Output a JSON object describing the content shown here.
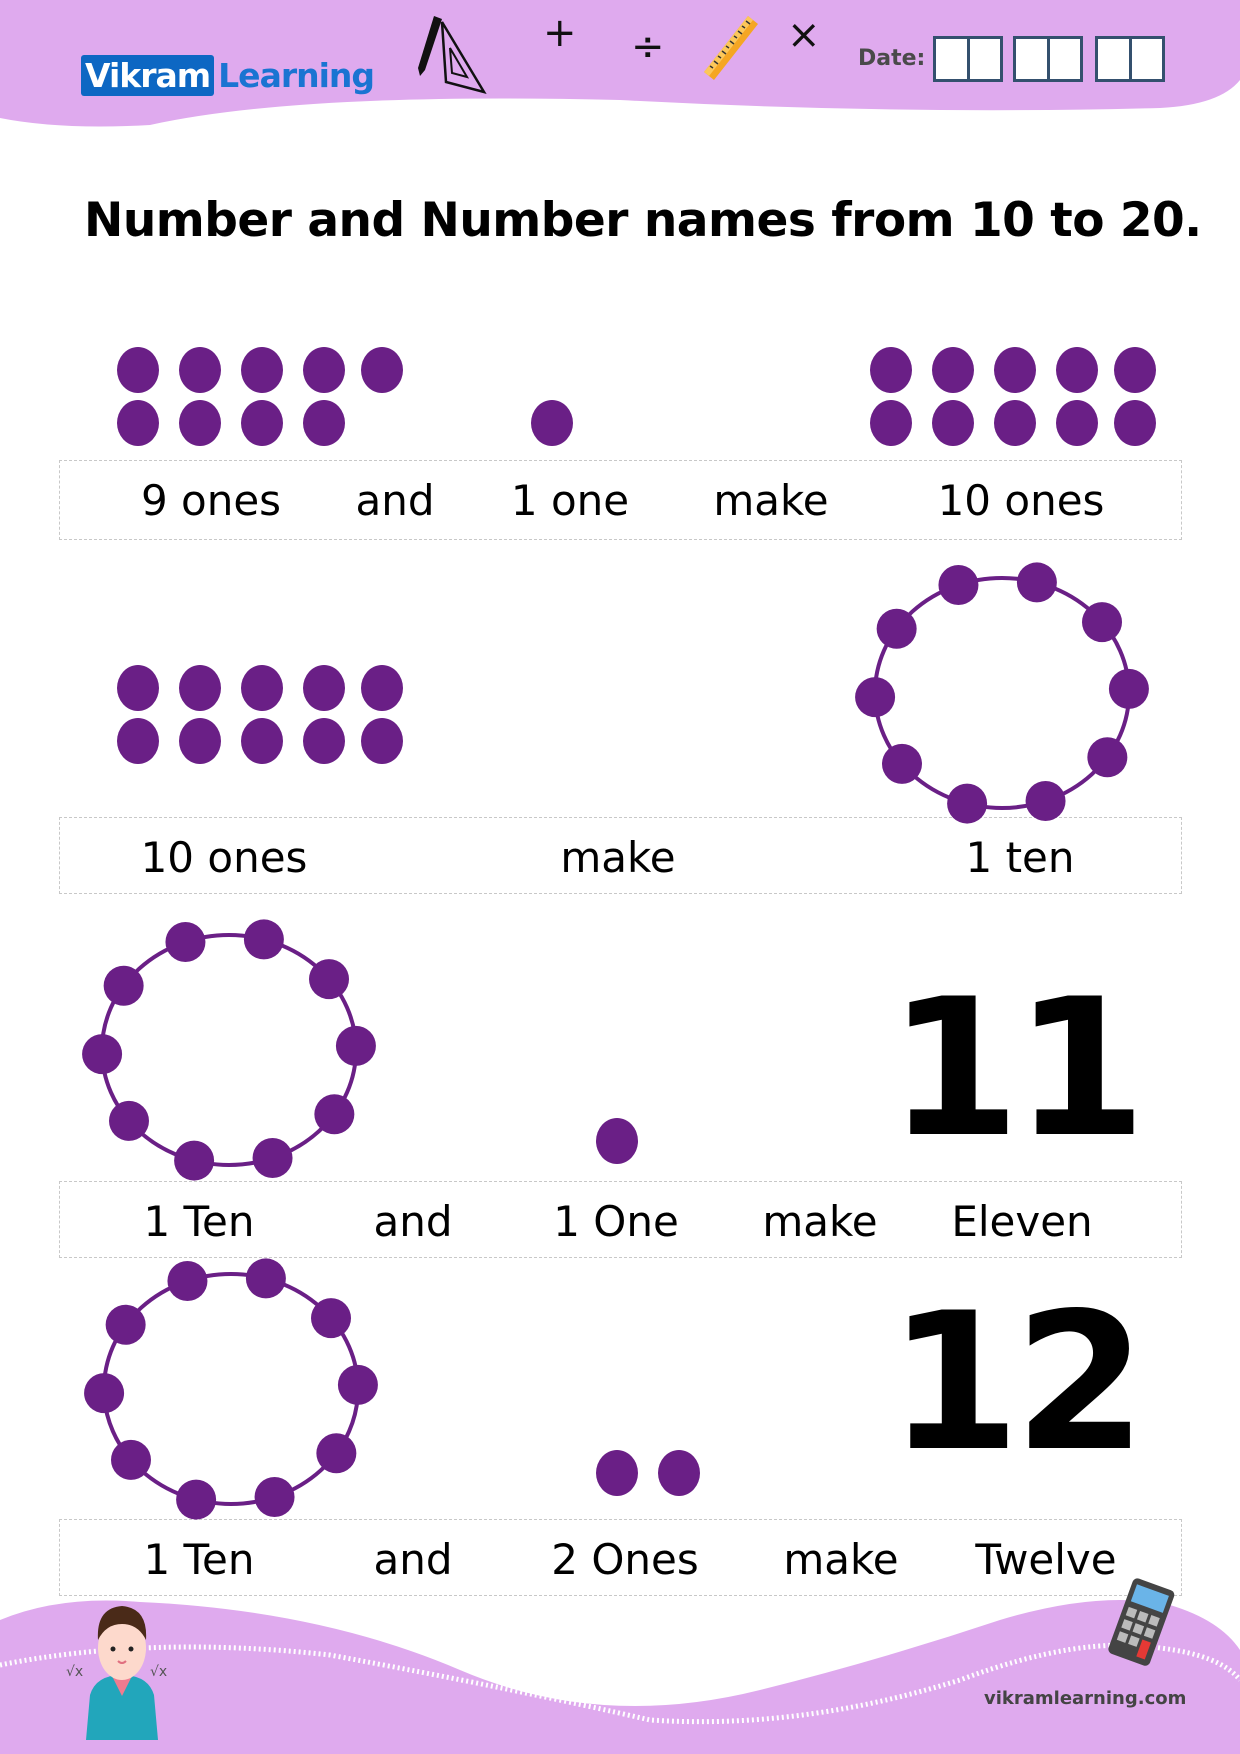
{
  "header": {
    "logo_part1": "Vikram",
    "logo_part2": "Learning",
    "symbols": {
      "plus": "+",
      "divide": "÷",
      "times": "×"
    },
    "date_label": "Date:",
    "date_boxes": 3
  },
  "title": "Number and Number names from 10 to 20.",
  "colors": {
    "dot": "#6a1f86",
    "header_bg": "#dfaaee",
    "logo_blue": "#0d67c3",
    "date_box_border": "#34506e"
  },
  "rows": [
    {
      "visual": {
        "left_dots": 9,
        "middle_dots": 1,
        "right_dots": 10
      },
      "words": [
        "9 ones",
        "and",
        "1 one",
        "make",
        "10 ones"
      ]
    },
    {
      "visual": {
        "left_dots": 10,
        "right_ring_dots": 10
      },
      "words": [
        "10 ones",
        "make",
        "1 ten"
      ]
    },
    {
      "visual": {
        "left_ring_dots": 10,
        "middle_dots": 1,
        "number": "11"
      },
      "words": [
        "1 Ten",
        "and",
        "1 One",
        "make",
        "Eleven"
      ]
    },
    {
      "visual": {
        "left_ring_dots": 10,
        "middle_dots": 2,
        "number": "12"
      },
      "words": [
        "1 Ten",
        "and",
        "2 Ones",
        "make",
        "Twelve"
      ]
    }
  ],
  "footer": {
    "website": "vikramlearning.com",
    "icons": [
      "boy-character-icon",
      "calculator-icon"
    ]
  }
}
